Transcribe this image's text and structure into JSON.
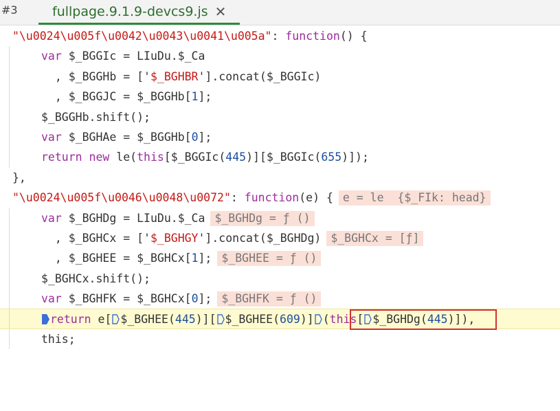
{
  "tabs": {
    "num_label": "#3",
    "active_label": "fullpage.9.1.9-devcs9.js",
    "close_icon": "close-icon"
  },
  "code": {
    "l1_key": "\"\\u0024\\u005f\\u0042\\u0043\\u0041\\u005a\"",
    "l1_rest": ": ",
    "l1_fn": "function",
    "l1_tail": "() {",
    "l2_var": "var",
    "l2_rest": " $_BGGIc = LIuDu.$_Ca",
    "l3_a": "  , $_BGGHb = ['",
    "l3_str": "$_BGHBR",
    "l3_b": "'].concat($_BGGIc)",
    "l4_a": "  , $_BGGJC = $_BGGHb[",
    "l4_num": "1",
    "l4_b": "];",
    "l5": "$_BGGHb.shift();",
    "l6_var": "var",
    "l6_a": " $_BGHAe = $_BGGHb[",
    "l6_num": "0",
    "l6_b": "];",
    "l7_ret": "return",
    "l7_new": "new",
    "l7_a": " le(",
    "l7_this": "this",
    "l7_b": "[$_BGGIc(",
    "l7_n1": "445",
    "l7_c": ")][$_BGGIc(",
    "l7_n2": "655",
    "l7_d": ")]);",
    "l8": "},",
    "l9_key": "\"\\u0024\\u005f\\u0046\\u0048\\u0072\"",
    "l9_rest": ": ",
    "l9_fn": "function",
    "l9_tail": "(e) {",
    "l9_inline": "e = le  {$_FIk: head}",
    "l10_var": "var",
    "l10_rest": " $_BGHDg = LIuDu.$_Ca",
    "l10_inline": "$_BGHDg = ƒ ()",
    "l11_a": "  , $_BGHCx = ['",
    "l11_str": "$_BGHGY",
    "l11_b": "'].concat($_BGHDg)",
    "l11_inline": "$_BGHCx = [ƒ]",
    "l12_a": "  , $_BGHEE = $_BGHCx[",
    "l12_num": "1",
    "l12_b": "];",
    "l12_inline": "$_BGHEE = ƒ ()",
    "l13": "$_BGHCx.shift();",
    "l14_var": "var",
    "l14_a": " $_BGHFK = $_BGHCx[",
    "l14_num": "0",
    "l14_b": "];",
    "l14_inline": "$_BGHFK = ƒ ()",
    "l15_ret": "return",
    "l15_a": " e[",
    "l15_b": "$_BGHEE(",
    "l15_n1": "445",
    "l15_c": ")][",
    "l15_d": "$_BGHEE(",
    "l15_n2": "609",
    "l15_e": ")]",
    "l15_this": "this",
    "l15_f": "[",
    "l15_g": "$_BGHDg(",
    "l15_n3": "445",
    "l15_h": ")]",
    "l15_i": "),",
    "l16": "this;"
  },
  "colors": {
    "string": "#c41a16",
    "keyword": "#9c2c9c",
    "number": "#1c4f9c",
    "inline_value_bg": "#fbe0d8",
    "highlight_line": "#fffbd0",
    "breakpoint_marker": "#3b6fd9",
    "tab_accent": "#2f8a3b"
  }
}
